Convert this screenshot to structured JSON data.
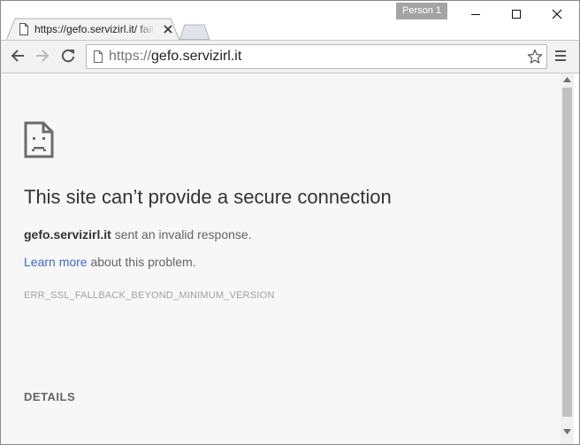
{
  "window": {
    "profile_name": "Person 1"
  },
  "tab": {
    "title": "https://gefo.servizirl.it/ failed to load"
  },
  "omnibox": {
    "url_scheme": "https://",
    "url_host": "gefo.servizirl.it"
  },
  "error": {
    "title": "This site can’t provide a secure connection",
    "host": "gefo.servizirl.it",
    "summary_suffix": " sent an invalid response.",
    "learn_more_label": "Learn more",
    "learn_more_suffix": " about this problem.",
    "code": "ERR_SSL_FALLBACK_BEYOND_MINIMUM_VERSION",
    "details_label": "DETAILS"
  },
  "colors": {
    "page_background": "#f7f7f7",
    "link": "#4169c8",
    "toolbar": "#f2f2f2"
  },
  "icons": {
    "page": "page-icon",
    "close": "close-icon",
    "back": "back-arrow-icon",
    "forward": "forward-arrow-icon",
    "reload": "reload-icon",
    "star": "star-icon",
    "menu": "hamburger-menu-icon",
    "sad_page": "sad-page-icon"
  }
}
